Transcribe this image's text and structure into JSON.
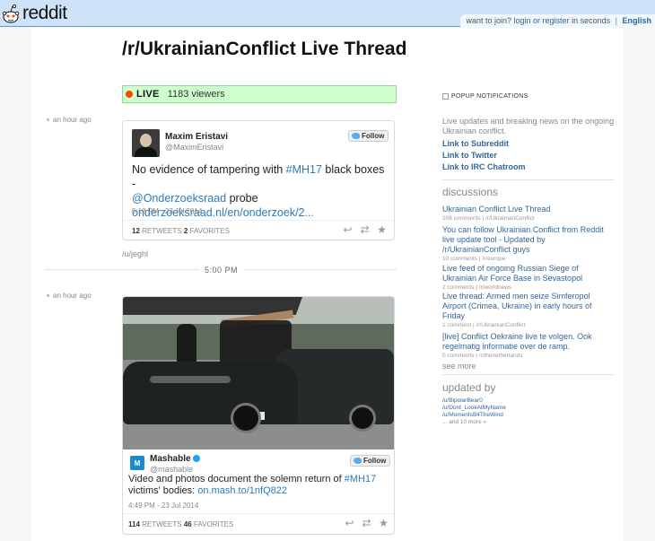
{
  "header": {
    "logo_text": "reddit",
    "join_text": "want to join?",
    "login_text": "login or register",
    "seconds_text": "in seconds",
    "language": "English"
  },
  "thread": {
    "title": "/r/UkrainianConflict Live Thread",
    "live_label": "LIVE",
    "viewers": "1183 viewers"
  },
  "updates": [
    {
      "time": "an hour ago",
      "tweet": {
        "name": "Maxim Eristavi",
        "handle": "@MaximEristavi",
        "follow_label": "Follow",
        "text_before": "No evidence of tampering with ",
        "hashtag": "#MH17",
        "text_middle": " black boxes - ",
        "mention": "@Onderzoeksraad",
        "text_after": " probe",
        "url": "onderzoeksraad.nl/en/onderzoek/2...",
        "date": "5:18 PM - 23 Jul 2014",
        "retweets": "12",
        "retweets_label": "RETWEETS",
        "favorites": "2",
        "favorites_label": "FAVORITES"
      },
      "author": "/u/jeghl"
    },
    {
      "time": "an hour ago",
      "tweet": {
        "name": "Mashable",
        "handle": "@mashable",
        "avatar_letter": "M",
        "follow_label": "Follow",
        "text_before": "Video and photos document the solemn return of ",
        "hashtag": "#MH17",
        "text_middle": " victims' bodies: ",
        "url": "on.mash.to/1nfQ822",
        "date": "4:49 PM - 23 Jul 2014",
        "retweets": "114",
        "retweets_label": "RETWEETS",
        "favorites": "46",
        "favorites_label": "FAVORITES"
      }
    }
  ],
  "time_separator": "5:00 PM",
  "sidebar": {
    "popup_label": "POPUP NOTIFICATIONS",
    "description": "Live updates and breaking news on the ongoing Ukrainian conflict.",
    "links": [
      "Link to Subreddit",
      "Link to Twitter",
      "Link to IRC Chatroom"
    ],
    "discussions_heading": "discussions",
    "discussions": [
      {
        "title": "Ukrainian Conflict Live Thread",
        "meta": "208 comments | /r/UkrainianConflict"
      },
      {
        "title": "You can follow Ukrainian Conflict from Reddit live update tool - Updated by /r/UkrainianConflict guys",
        "meta": "10 comments | /r/europe"
      },
      {
        "title": "Live feed of ongoing Russian Siege of Ukrainian Air Force Base in Sevastopol",
        "meta": "2 comments | /r/worldnews"
      },
      {
        "title": "Live thread: Armed men seize Simferopol Airport (Crimea, Ukraine) in early hours of Friday",
        "meta": "1 comment | /r/UkrainianConflict"
      },
      {
        "title": "[live] Conflict Oekraine live te volgen. Ook regelmatig informatie over de ramp.",
        "meta": "0 comments | /r/thenetherlands"
      }
    ],
    "see_more": "see more",
    "updated_by_heading": "updated by",
    "updated_by": [
      "/u/BipolarBear0",
      "/u/Dont_LookAtMyName",
      "/u/MomentsB4TheWind"
    ],
    "updated_by_more": "... and 10 more »"
  }
}
